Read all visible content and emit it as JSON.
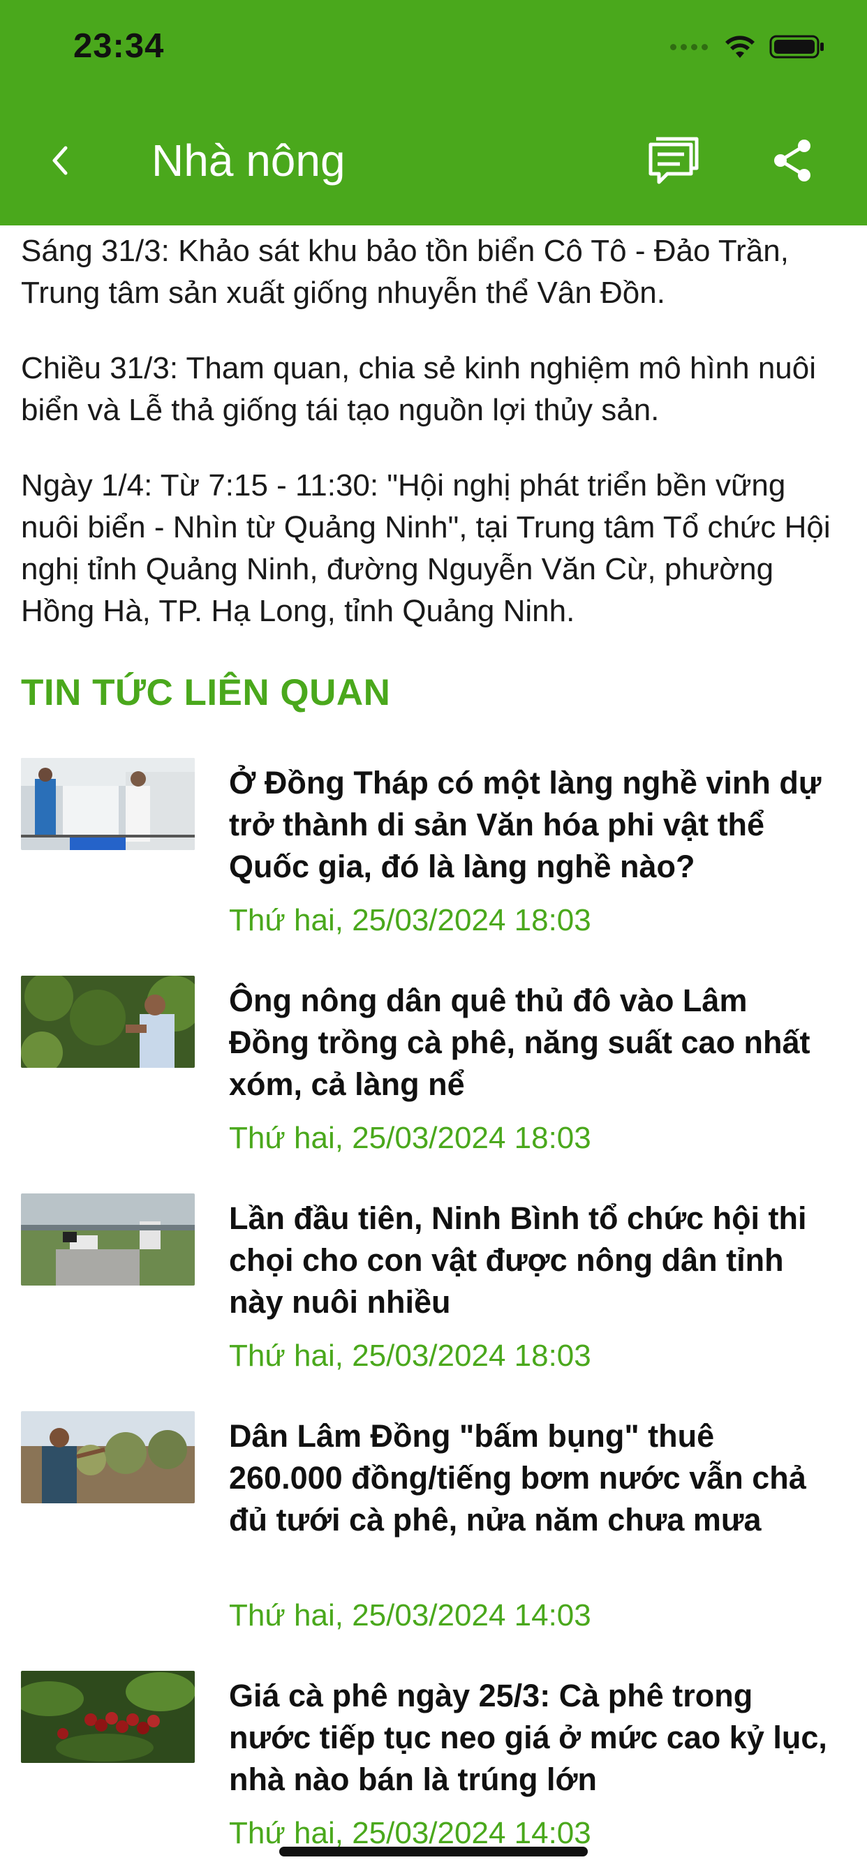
{
  "status_bar": {
    "time": "23:34"
  },
  "nav": {
    "title": "Nhà nông",
    "back_icon": "chevron-left-icon",
    "comment_icon": "comment-icon",
    "share_icon": "share-icon"
  },
  "article": {
    "paragraphs": [
      "Sáng 31/3: Khảo sát khu bảo tồn biển Cô Tô - Đảo Trần, Trung tâm sản xuất giống nhuyễn thể Vân Đồn.",
      "Chiều 31/3: Tham quan, chia sẻ kinh nghiệm mô hình nuôi biển và Lễ thả giống tái tạo nguồn lợi thủy sản.",
      "Ngày 1/4: Từ 7:15 - 11:30: \"Hội nghị phát triển bền vững nuôi biển - Nhìn từ Quảng Ninh\", tại Trung tâm Tổ chức Hội nghị tỉnh Quảng Ninh, đường Nguyễn Văn Cừ, phường Hồng Hà, TP. Hạ Long, tỉnh Quảng Ninh."
    ]
  },
  "related": {
    "heading": "TIN TỨC LIÊN QUAN",
    "items": [
      {
        "title": "Ở Đồng Tháp có một làng nghề vinh dự trở thành di sản Văn hóa phi vật thể Quốc gia, đó là làng nghề nào?",
        "date": "Thứ hai, 25/03/2024 18:03"
      },
      {
        "title": "Ông nông dân quê thủ đô vào Lâm Đồng trồng cà phê, năng suất cao nhất xóm, cả làng nể",
        "date": "Thứ hai, 25/03/2024 18:03"
      },
      {
        "title": "Lần đầu tiên, Ninh Bình tổ chức hội thi chọi cho con vật được nông dân tỉnh này nuôi nhiều",
        "date": "Thứ hai, 25/03/2024 18:03"
      },
      {
        "title": "Dân Lâm Đồng \"bấm bụng\" thuê 260.000 đồng/tiếng bơm nước vẫn chả đủ tưới cà phê, nửa năm chưa mưa",
        "date": "Thứ hai, 25/03/2024 14:03"
      },
      {
        "title": "Giá cà phê ngày 25/3: Cà phê trong nước tiếp tục neo giá ở mức cao kỷ lục, nhà nào bán là trúng lớn",
        "date": "Thứ hai, 25/03/2024 14:03"
      }
    ]
  },
  "colors": {
    "brand_green": "#4aa81c",
    "text": "#1a1a1a"
  }
}
